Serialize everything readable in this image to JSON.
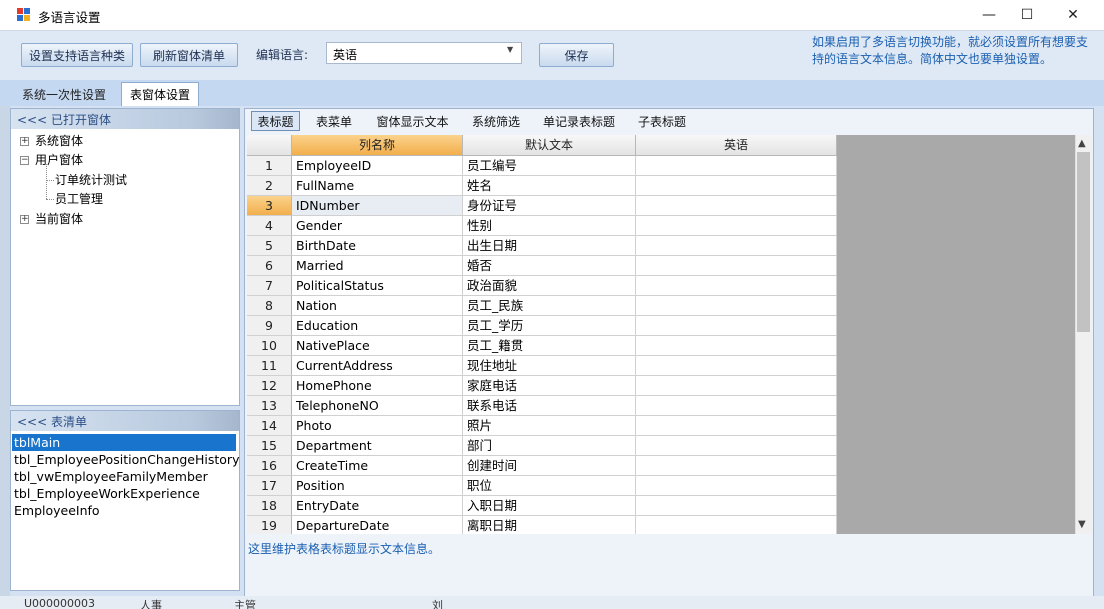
{
  "window": {
    "title": "多语言设置",
    "minimize_glyph": "—",
    "maximize_glyph": "☐",
    "close_glyph": "✕"
  },
  "toolbar": {
    "btn_languages": "设置支持语言种类",
    "btn_refresh": "刷新窗体清单",
    "edit_language_label": "编辑语言:",
    "edit_language_value": "英语",
    "btn_save": "保存",
    "notice": "如果启用了多语言切换功能，就必须设置所有想要支持的语言文本信息。简体中文也要单独设置。"
  },
  "main_tabs": [
    "系统一次性设置",
    "表窗体设置"
  ],
  "open_forms": {
    "header": "<<< 已打开窗体",
    "tree": [
      {
        "label": "系统窗体",
        "level": 0,
        "expander": "+"
      },
      {
        "label": "用户窗体",
        "level": 0,
        "expander": "−"
      },
      {
        "label": "订单统计测试",
        "level": 1
      },
      {
        "label": "员工管理",
        "level": 1
      },
      {
        "label": "当前窗体",
        "level": 0,
        "expander": "+"
      }
    ]
  },
  "table_list": {
    "header": "<<< 表清单",
    "items": [
      "tblMain",
      "tbl_EmployeePositionChangeHistory",
      "tbl_vwEmployeeFamilyMember",
      "tbl_EmployeeWorkExperience",
      "EmployeeInfo"
    ],
    "selected": "tblMain"
  },
  "sub_tabs": [
    "表标题",
    "表菜单",
    "窗体显示文本",
    "系统筛选",
    "单记录表标题",
    "子表标题"
  ],
  "grid": {
    "columns": [
      "列名称",
      "默认文本",
      "英语"
    ],
    "rows": [
      {
        "n": "1",
        "col": "EmployeeID",
        "def": "员工编号",
        "en": ""
      },
      {
        "n": "2",
        "col": "FullName",
        "def": "姓名",
        "en": ""
      },
      {
        "n": "3",
        "col": "IDNumber",
        "def": "身份证号",
        "en": ""
      },
      {
        "n": "4",
        "col": "Gender",
        "def": "性别",
        "en": ""
      },
      {
        "n": "5",
        "col": "BirthDate",
        "def": "出生日期",
        "en": ""
      },
      {
        "n": "6",
        "col": "Married",
        "def": "婚否",
        "en": ""
      },
      {
        "n": "7",
        "col": "PoliticalStatus",
        "def": "政治面貌",
        "en": ""
      },
      {
        "n": "8",
        "col": "Nation",
        "def": "员工_民族",
        "en": ""
      },
      {
        "n": "9",
        "col": "Education",
        "def": "员工_学历",
        "en": ""
      },
      {
        "n": "10",
        "col": "NativePlace",
        "def": "员工_籍贯",
        "en": ""
      },
      {
        "n": "11",
        "col": "CurrentAddress",
        "def": "现住地址",
        "en": ""
      },
      {
        "n": "12",
        "col": "HomePhone",
        "def": "家庭电话",
        "en": ""
      },
      {
        "n": "13",
        "col": "TelephoneNO",
        "def": "联系电话",
        "en": ""
      },
      {
        "n": "14",
        "col": "Photo",
        "def": "照片",
        "en": ""
      },
      {
        "n": "15",
        "col": "Department",
        "def": "部门",
        "en": ""
      },
      {
        "n": "16",
        "col": "CreateTime",
        "def": "创建时间",
        "en": ""
      },
      {
        "n": "17",
        "col": "Position",
        "def": "职位",
        "en": ""
      },
      {
        "n": "18",
        "col": "EntryDate",
        "def": "入职日期",
        "en": ""
      },
      {
        "n": "19",
        "col": "DepartureDate",
        "def": "离职日期",
        "en": ""
      }
    ],
    "current_row": "3"
  },
  "footer": "这里维护表格表标题显示文本信息。",
  "background": {
    "frag1": "U000000003",
    "frag2": "人事",
    "frag3": "主管",
    "frag4": "刘"
  },
  "colors": {
    "toolbar_bg": "#dfe9f5",
    "tab_bg": "#c4d8f1",
    "selected_blue": "#1874cd",
    "header_orange": "#f2ae4b",
    "notice_blue": "#1a5fb0"
  }
}
